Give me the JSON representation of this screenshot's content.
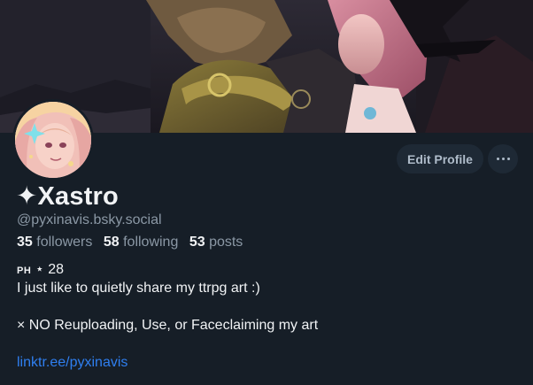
{
  "profile": {
    "display_name": "✦Xastro",
    "handle": "@pyxinavis.bsky.social",
    "stats": {
      "followers_count": "35",
      "followers_label": "followers",
      "following_count": "58",
      "following_label": "following",
      "posts_count": "53",
      "posts_label": "posts"
    },
    "bio": {
      "line1_prefix": "PH",
      "line1_rest": " ⋆ 28",
      "line2": "I just like to quietly share my ttrpg art :)",
      "line3": "× NO Reuploading, Use, or Faceclaiming my art",
      "link": "linktr.ee/pyxinavis"
    }
  },
  "actions": {
    "edit_profile_label": "Edit Profile",
    "more_icon": "ellipsis-icon"
  },
  "colors": {
    "background": "#161e27",
    "button_bg": "#1e2935",
    "muted_text": "#8b98a5",
    "link": "#2f7ff0"
  }
}
